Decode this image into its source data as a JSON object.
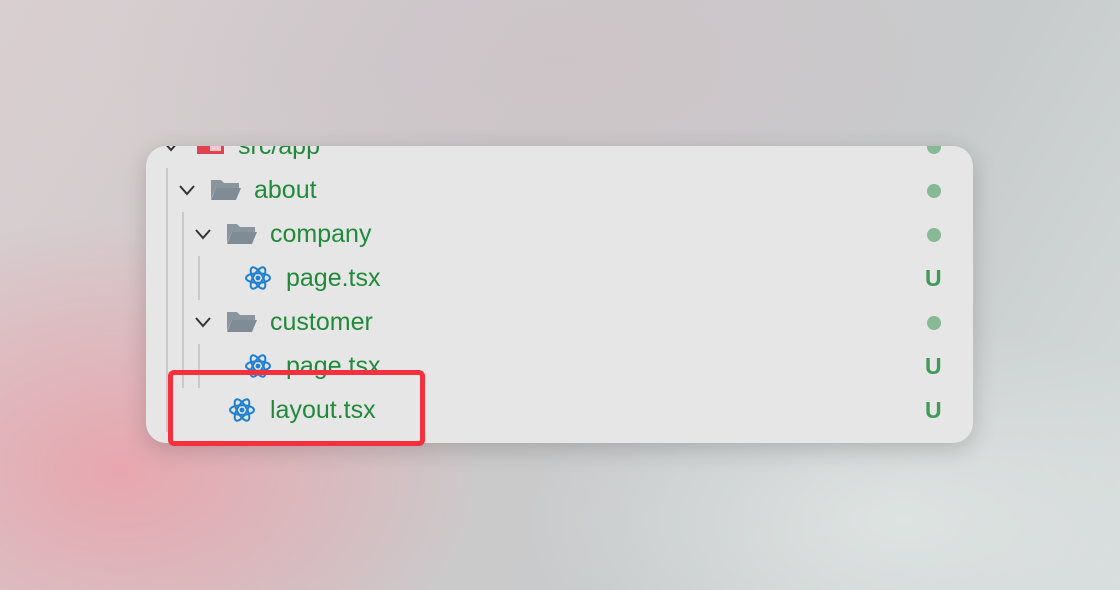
{
  "tree": {
    "root": {
      "label": "src/app",
      "icon": "app-folder-icon"
    },
    "items": [
      {
        "label": "about",
        "type": "folder",
        "expanded": true,
        "status": "dot"
      },
      {
        "label": "company",
        "type": "folder",
        "expanded": true,
        "status": "dot"
      },
      {
        "label": "page.tsx",
        "type": "file",
        "icon": "react-icon",
        "status": "U"
      },
      {
        "label": "customer",
        "type": "folder",
        "expanded": true,
        "status": "dot"
      },
      {
        "label": "page.tsx",
        "type": "file",
        "icon": "react-icon",
        "status": "U"
      },
      {
        "label": "layout.tsx",
        "type": "file",
        "icon": "react-icon",
        "status": "U",
        "highlighted": true
      }
    ]
  },
  "colors": {
    "name_text": "#218a3a",
    "status_dot": "#86b994",
    "status_untracked": "#3f9a58",
    "highlight_border": "#f5303e",
    "react_icon": "#1f7fd1",
    "folder_icon": "#7f8c95"
  }
}
